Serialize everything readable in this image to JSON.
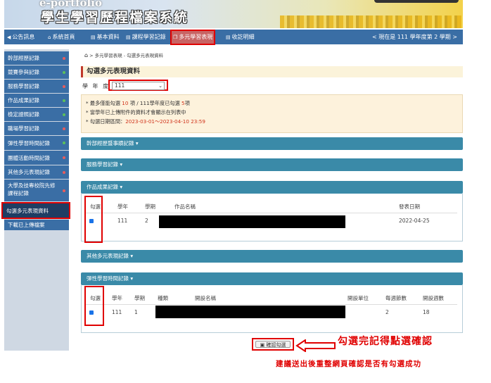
{
  "banner": {
    "eportfolio": "e-portfolio",
    "title": "學生學習歷程檔案系統"
  },
  "nav": {
    "items": [
      {
        "label": "公告訊息",
        "icon": "megaphone-icon"
      },
      {
        "label": "系統首頁",
        "icon": "home-icon"
      },
      {
        "label": "基本資料",
        "icon": "document-icon"
      },
      {
        "label": "課程學習記錄",
        "icon": "document-icon"
      },
      {
        "label": "多元學習表現",
        "icon": "copy-icon"
      },
      {
        "label": "收訖明細",
        "icon": "document-icon"
      }
    ],
    "current_term": "< 現在是 111 學年度第 2 學期 >"
  },
  "sidebar": {
    "items": [
      {
        "label": "幹部經歷記錄",
        "dot": "#e85d5d"
      },
      {
        "label": "競賽參與記錄",
        "dot": "#5cc05c"
      },
      {
        "label": "服務學習記錄",
        "dot": "#e85d5d"
      },
      {
        "label": "作品成果記錄",
        "dot": "#5cc05c"
      },
      {
        "label": "檢定證照記錄",
        "dot": "#5cc05c"
      },
      {
        "label": "職場學習記錄",
        "dot": "#e85d5d"
      },
      {
        "label": "彈性學習時間記錄",
        "dot": "#5cc05c"
      },
      {
        "label": "團體活動時間記錄",
        "dot": "#e85d5d"
      },
      {
        "label": "其他多元表現記錄",
        "dot": "#e85d5d"
      },
      {
        "label": "大學及技專校院先修課程記錄",
        "dot": "#e85d5d"
      },
      {
        "label": "勾選多元表現資料",
        "dot": ""
      },
      {
        "label": "下載已上傳檔案",
        "dot": ""
      }
    ]
  },
  "breadcrumb": {
    "text": "多元學習表現 - 勾選多元表現資料"
  },
  "page_title": "勾選多元表現資料",
  "year": {
    "label": "學 年 度",
    "selected": "111"
  },
  "notice": {
    "line1_prefix": "* 最多僅能勾選 ",
    "line1_n1": "10",
    "line1_mid": " 項 / 111學年度已勾選 ",
    "line1_n2": "5",
    "line1_suffix": "項",
    "line2": "* 當學年已上傳附件的資料才會顯示在列表中",
    "line3_prefix": "* 勾選日期區間：",
    "line3_range": "2023-03-01～2023-04-10 23:59"
  },
  "panels": {
    "cadre": "幹部經歷暨事蹟記錄",
    "service": "服務學習記錄",
    "works": {
      "title": "作品成果記錄",
      "headers": [
        "勾選",
        "學年",
        "學期",
        "作品名稱",
        "發表日期"
      ],
      "rows": [
        {
          "year": "111",
          "sem": "2",
          "date": "2022-04-25"
        }
      ]
    },
    "other": "其他多元表現記錄",
    "flex": {
      "title": "彈性學習時間記錄",
      "headers": [
        "勾選",
        "學年",
        "學期",
        "種類",
        "開設名稱",
        "開設單位",
        "每週節數",
        "開設週數"
      ],
      "rows": [
        {
          "year": "111",
          "sem": "1",
          "hours": "2",
          "weeks": "18"
        }
      ]
    }
  },
  "confirm_label": "確認勾選",
  "annotation": {
    "instruction": "勾選完記得點選確認",
    "note": "建議送出後重整網頁確認是否有勾選成功"
  }
}
